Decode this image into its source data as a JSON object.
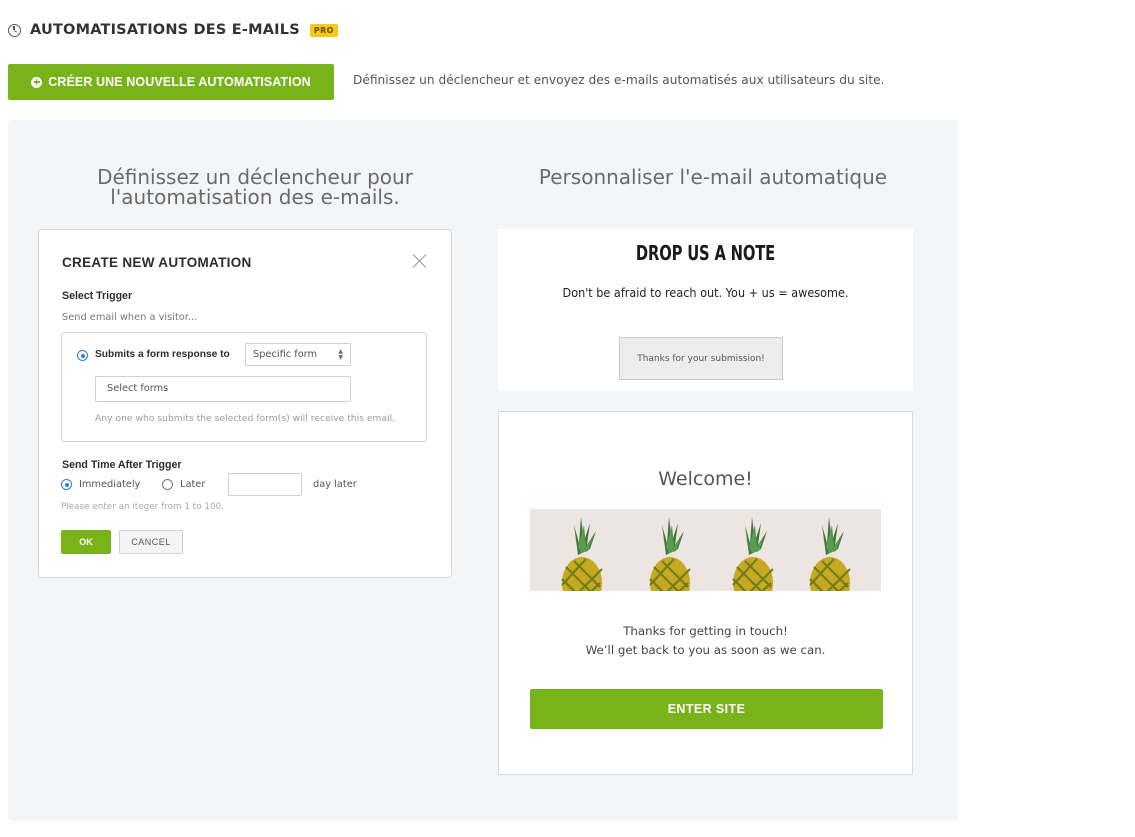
{
  "header": {
    "title": "AUTOMATISATIONS DES E-MAILS",
    "badge": "PRO",
    "icon": "clock-icon"
  },
  "create": {
    "button_label": "CRÉER UNE NOUVELLE AUTOMATISATION",
    "description": "Définissez un déclencheur et envoyez des e-mails automatisés aux utilisateurs du site."
  },
  "left_column": {
    "title_line1": "Définissez un déclencheur pour",
    "title_line2": "l'automatisation des e-mails."
  },
  "right_column": {
    "title": "Personnaliser l'e-mail automatique"
  },
  "dialog": {
    "title": "CREATE NEW AUTOMATION",
    "select_trigger_label": "Select Trigger",
    "select_trigger_sub": "Send email when a visitor...",
    "trigger_option_label": "Submits a form response to",
    "form_select_value": "Specific form",
    "forms_input_placeholder": "Select forms",
    "help_text": "Any one who submits the selected form(s) will receive this email.",
    "send_time_label": "Send Time After Trigger",
    "option_immediately": "Immediately",
    "option_later": "Later",
    "day_later": "day later",
    "error_text": "Please enter an iteger  from 1 to 100.",
    "ok_label": "OK",
    "cancel_label": "CANCEL"
  },
  "note_preview": {
    "title": "DROP US A NOTE",
    "subtitle": "Don't be afraid to reach out. You + us = awesome.",
    "button": "Thanks for your submission!"
  },
  "email_preview": {
    "welcome": "Welcome!",
    "body_line1": "Thanks for getting in touch!",
    "body_line2": "We’ll get back to you as soon as we can.",
    "button": "ENTER SITE"
  },
  "colors": {
    "accent": "#78b31a",
    "badge": "#f7c816",
    "radio": "#2d7ce6",
    "panel": "#f4f5f7"
  }
}
